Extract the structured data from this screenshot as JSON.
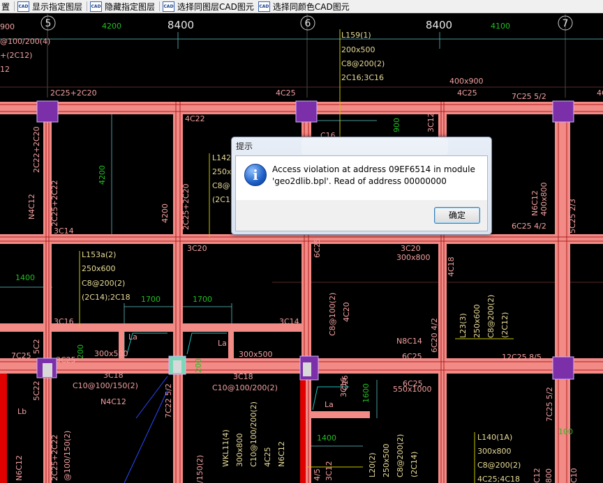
{
  "toolbar": {
    "items": [
      {
        "label": "置"
      },
      {
        "label": "显示指定图层",
        "icon": "CAD"
      },
      {
        "label": "隐藏指定图层",
        "icon": "CAD"
      },
      {
        "label": "选择同图层CAD图元",
        "icon": "CAD"
      },
      {
        "label": "选择同颜色CAD图元",
        "icon": "CAD"
      }
    ]
  },
  "drawing": {
    "axis_numbers": [
      "5",
      "6",
      "7"
    ],
    "dim_large": [
      "8400",
      "8400"
    ],
    "dims_green": [
      "4200",
      "4100",
      "4200",
      "1400",
      "1700",
      "1700",
      "200",
      "200",
      "900",
      "1600",
      "1400",
      "100"
    ],
    "texts_beige": {
      "l159": [
        "L159(1)",
        "200x500",
        "C8@200(2)",
        "2C16;3C16"
      ],
      "l142": [
        "L142",
        "250x",
        "C8@",
        "(2C1"
      ],
      "l153": [
        "L153a(2)",
        "250x600",
        "C8@200(2)",
        "(2C14);2C18"
      ],
      "l140": [
        "L140(1A)",
        "300x800",
        "C8@200(2)",
        "4C25;4C18"
      ],
      "vert": [
        "L23(3)",
        "250x600",
        "C8@200(2)",
        "(2C12)",
        "WKL11(4)",
        "300x800",
        "C10@100/200(2)",
        "4C25",
        "N6C12",
        "L20(2)",
        "250x500",
        "C8@200(2)",
        "(2C14)"
      ]
    },
    "texts_pink": [
      "900",
      "@100/200(4)",
      "+(2C12)",
      "12",
      "2C25+2C20",
      "4C25",
      "4C25",
      "400x900",
      "7C25 5/2",
      "4C25",
      "4C22",
      "C16",
      "3C12",
      "2C22+2C20",
      "N4C12",
      "2C25+2C22",
      "3C14",
      "4200",
      "2C25+2C20",
      "3C20",
      "3C20",
      "300x800",
      "6C25",
      "4C18",
      "6C25 4/2",
      "N6C12",
      "400x800",
      "5C25 2/3",
      "3C16",
      "3C14",
      "C8@100(2)",
      "4C20",
      "N8C14",
      "6C20 4/2",
      "6C25",
      "12C25 8/5",
      "7C25",
      "3C25",
      "300x500",
      "3C18",
      "300x500",
      "3C18",
      "C10@100/150(2)",
      "C10@100/200(2)",
      "N4C12",
      "6C25",
      "550x1000",
      "3C16",
      "La",
      "La",
      "La",
      "Lb",
      "5C22",
      "N6C12",
      "2C25+2C22",
      "@100/150(2)",
      "7C22 5/2",
      "/150(2)",
      "7C25 5/2",
      "3C12",
      "4/5",
      "C12",
      "800",
      "C10",
      "C16",
      "5C2"
    ]
  },
  "dialog": {
    "title": "提示",
    "message": "Access violation at address 09EF6514 in module 'geo2dlib.bpl'. Read of address 00000000",
    "ok_label": "确定",
    "icon": "info-icon"
  }
}
